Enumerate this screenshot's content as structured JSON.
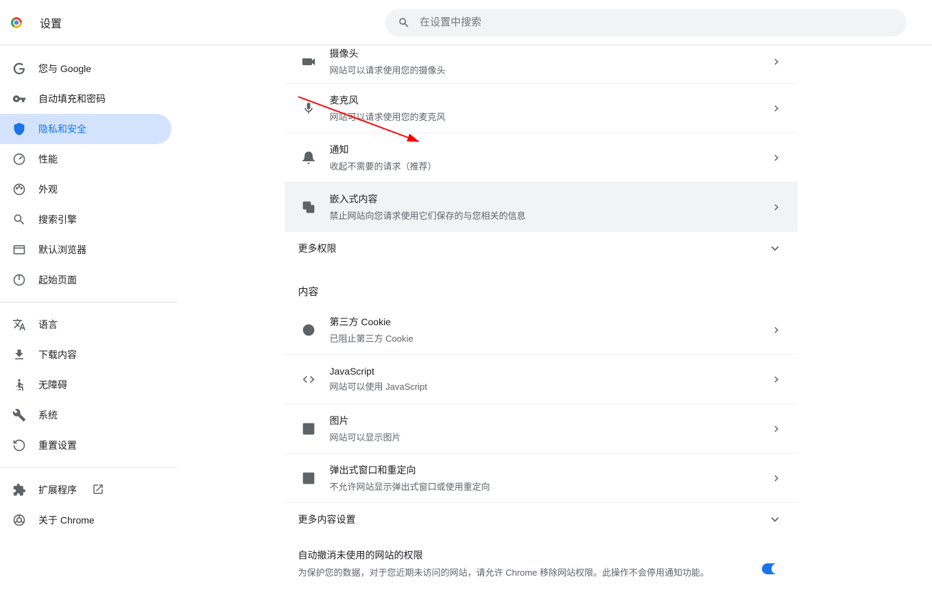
{
  "header": {
    "title": "设置",
    "search_placeholder": "在设置中搜索"
  },
  "sidebar": {
    "items": [
      {
        "label": "您与 Google"
      },
      {
        "label": "自动填充和密码"
      },
      {
        "label": "隐私和安全"
      },
      {
        "label": "性能"
      },
      {
        "label": "外观"
      },
      {
        "label": "搜索引擎"
      },
      {
        "label": "默认浏览器"
      },
      {
        "label": "起始页面"
      },
      {
        "label": "语言"
      },
      {
        "label": "下载内容"
      },
      {
        "label": "无障碍"
      },
      {
        "label": "系统"
      },
      {
        "label": "重置设置"
      },
      {
        "label": "扩展程序"
      },
      {
        "label": "关于 Chrome"
      }
    ]
  },
  "main": {
    "permissions": [
      {
        "title": "摄像头",
        "desc": "网站可以请求使用您的摄像头"
      },
      {
        "title": "麦克风",
        "desc": "网站可以请求使用您的麦克风"
      },
      {
        "title": "通知",
        "desc": "收起不需要的请求（推荐）"
      },
      {
        "title": "嵌入式内容",
        "desc": "禁止网站向您请求使用它们保存的与您相关的信息"
      }
    ],
    "more_permissions": "更多权限",
    "content_label": "内容",
    "content_items": [
      {
        "title": "第三方 Cookie",
        "desc": "已阻止第三方 Cookie"
      },
      {
        "title": "JavaScript",
        "desc": "网站可以使用 JavaScript"
      },
      {
        "title": "图片",
        "desc": "网站可以显示图片"
      },
      {
        "title": "弹出式窗口和重定向",
        "desc": "不允许网站显示弹出式窗口或使用重定向"
      }
    ],
    "more_content": "更多内容设置",
    "auto_revoke": {
      "title": "自动撤消未使用的网站的权限",
      "desc": "为保护您的数据，对于您近期未访问的网站，请允许 Chrome 移除网站权限。此操作不会停用通知功能。"
    }
  }
}
